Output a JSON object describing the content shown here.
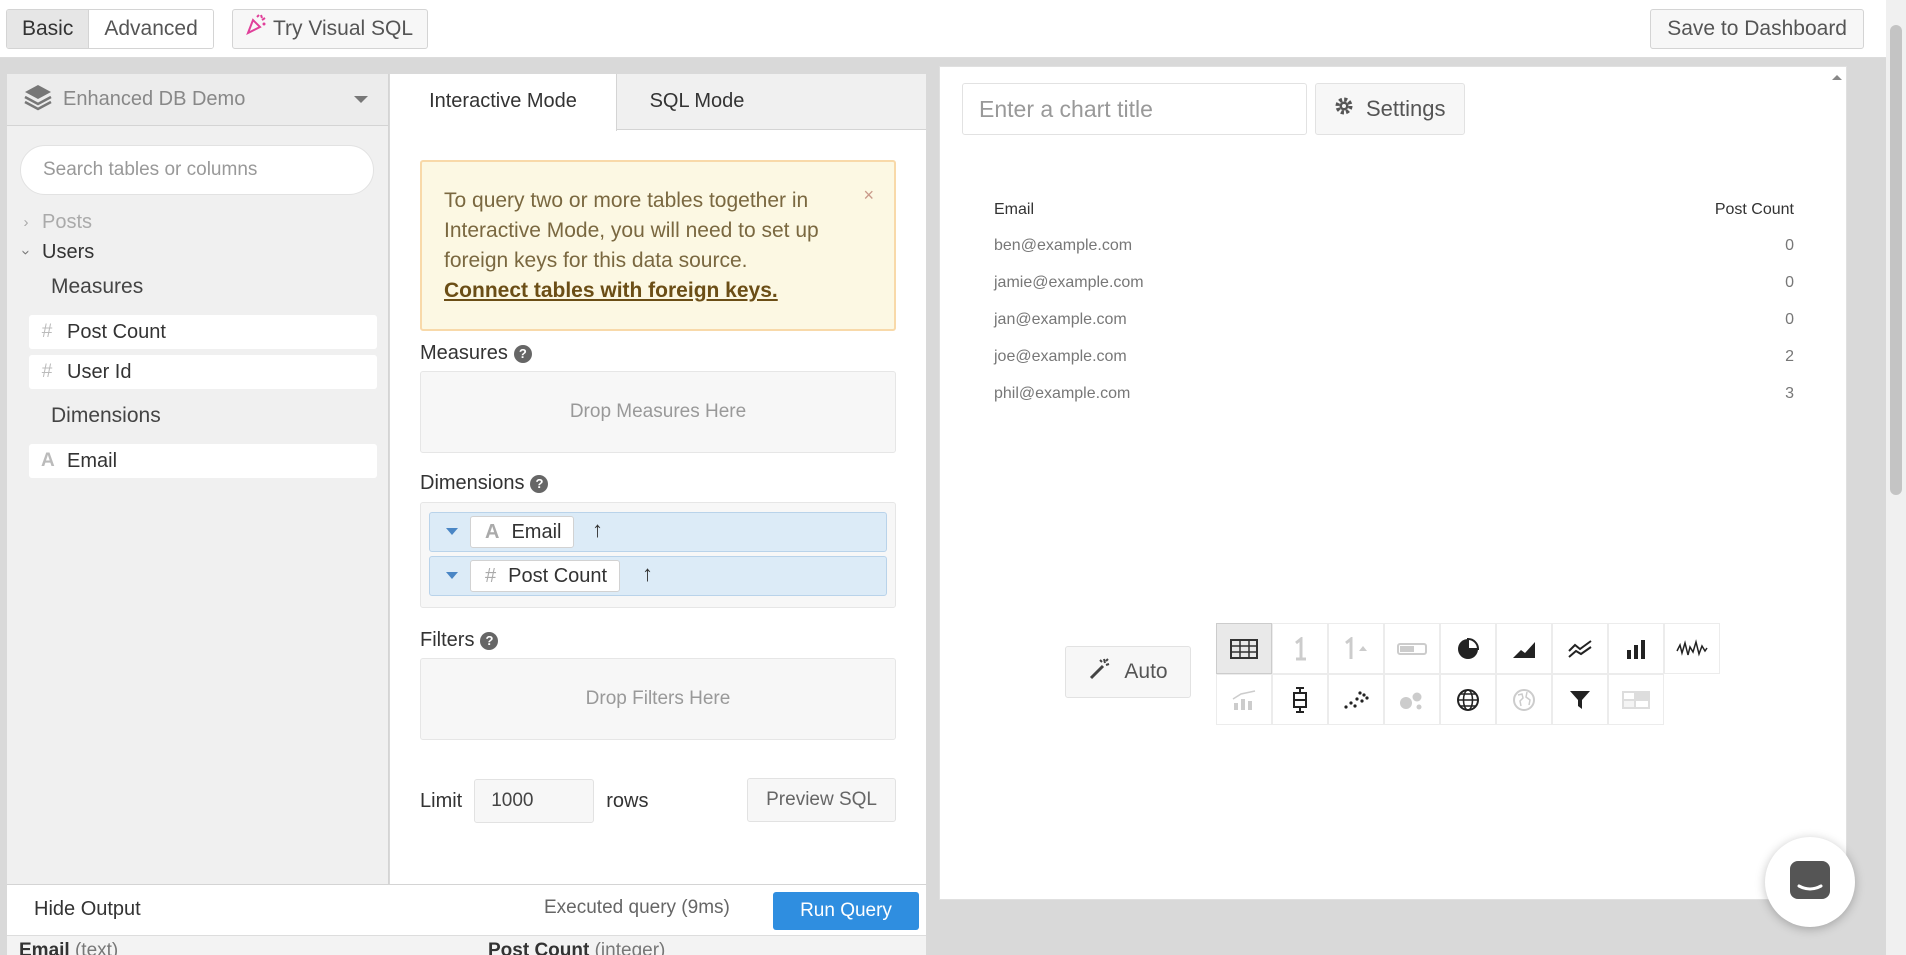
{
  "topbar": {
    "mode_basic": "Basic",
    "mode_advanced": "Advanced",
    "try_visual_sql": "Try Visual SQL",
    "save_to_dashboard": "Save to Dashboard"
  },
  "schema": {
    "datasource": "Enhanced DB Demo",
    "search_placeholder": "Search tables or columns",
    "tables": [
      {
        "label": "Posts",
        "expanded": false
      },
      {
        "label": "Users",
        "expanded": true
      }
    ],
    "measures_heading": "Measures",
    "measures": [
      {
        "symbol": "#",
        "label": "Post Count"
      },
      {
        "symbol": "#",
        "label": "User Id"
      }
    ],
    "dimensions_heading": "Dimensions",
    "dimensions": [
      {
        "symbol": "A",
        "label": "Email"
      }
    ]
  },
  "builder": {
    "tabs": [
      "Interactive Mode",
      "SQL Mode"
    ],
    "alert_text": "To query two or more tables together in Interactive Mode, you will need to set up foreign keys for this data source.",
    "alert_link": "Connect tables with foreign keys.",
    "alert_close": "×",
    "measures_heading": "Measures",
    "measures_drop": "Drop Measures Here",
    "dimensions_heading": "Dimensions",
    "dimension_pills": [
      {
        "symbol": "A",
        "label": "Email",
        "sort": "↑"
      },
      {
        "symbol": "#",
        "label": "Post Count",
        "sort": "↑"
      }
    ],
    "filters_heading": "Filters",
    "filters_drop": "Drop Filters Here",
    "limit_label": "Limit",
    "limit_value": "1000",
    "rows_label": "rows",
    "preview_sql": "Preview SQL",
    "help_mark": "?"
  },
  "output": {
    "hide_output": "Hide Output",
    "executed": "Executed query (9ms)",
    "run_query": "Run Query",
    "columns": [
      {
        "name": "Email",
        "type": "(text)"
      },
      {
        "name": "Post Count",
        "type": "(integer)"
      }
    ]
  },
  "chart": {
    "title_placeholder": "Enter a chart title",
    "settings": "Settings",
    "auto": "Auto",
    "table_headers": [
      "Email",
      "Post Count"
    ],
    "rows": [
      [
        "ben@example.com",
        "0"
      ],
      [
        "jamie@example.com",
        "0"
      ],
      [
        "jan@example.com",
        "0"
      ],
      [
        "joe@example.com",
        "2"
      ],
      [
        "phil@example.com",
        "3"
      ]
    ],
    "chart_types": [
      "table-icon",
      "single-value-icon",
      "single-value-trend-icon",
      "progress-bar-icon",
      "pie-chart-icon",
      "area-chart-icon",
      "line-chart-icon",
      "bar-chart-icon",
      "sparkline-icon",
      "bar-line-icon",
      "boxplot-icon",
      "scatter-icon",
      "bubble-icon",
      "globe-icon",
      "map-icon",
      "funnel-icon",
      "pivot-table-icon"
    ],
    "selected_type": "table-icon"
  },
  "colors": {
    "accent": "#2f8ee0",
    "alert_bg": "#fcf8e3",
    "pill_bg": "#dcebf7"
  }
}
